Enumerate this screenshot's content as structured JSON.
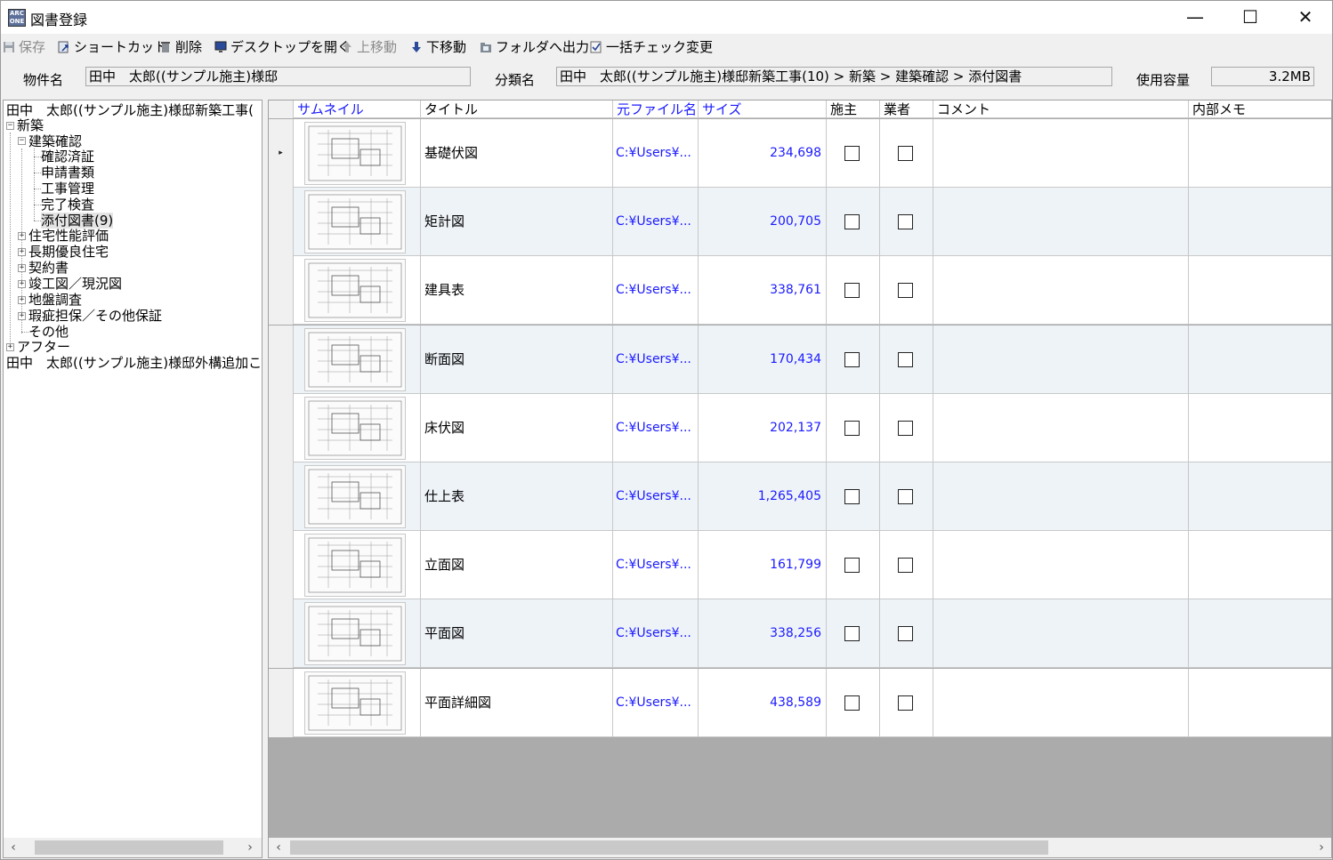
{
  "window": {
    "app_icon_text": "ARC ONE",
    "title": "図書登録",
    "minimize": "—",
    "maximize": "☐",
    "close": "✕"
  },
  "toolbar": {
    "save": "保存",
    "shortcut": "ショートカット",
    "delete": "削除",
    "open_desktop": "デスクトップを開く",
    "move_up": "上移動",
    "move_down": "下移動",
    "export_folder": "フォルダへ出力",
    "bulk_check": "一括チェック変更"
  },
  "header": {
    "property_label": "物件名",
    "property_value": "田中　太郎((サンプル施主)様邸",
    "category_label": "分類名",
    "category_value": "田中　太郎((サンプル施主)様邸新築工事(10) > 新築 > 建築確認 > 添付図書",
    "usage_label": "使用容量",
    "usage_value": "3.2MB"
  },
  "tree": {
    "root1": "田中　太郎((サンプル施主)様邸新築工事(",
    "shinchiku": "新築",
    "kenchiku_kakunin": "建築確認",
    "kakunin_zumisho": "確認済証",
    "shinsei_shorui": "申請書類",
    "koji_kanri": "工事管理",
    "kanryo_kensa": "完了検査",
    "tenpu_zusho": "添付図書(9)",
    "jutaku_seino": "住宅性能評価",
    "choki_yuryo": "長期優良住宅",
    "keiyakusho": "契約書",
    "shunkozu": "竣工図／現況図",
    "jiban_chosa": "地盤調査",
    "kashi_tanpo": "瑕疵担保／その他保証",
    "sonota": "その他",
    "after": "アフター",
    "root2": "田中　太郎((サンプル施主)様邸外構追加こ"
  },
  "grid": {
    "columns": {
      "thumbnail": "サムネイル",
      "title": "タイトル",
      "filename": "元ファイル名",
      "size": "サイズ",
      "owner": "施主",
      "vendor": "業者",
      "comment": "コメント",
      "memo": "内部メモ"
    },
    "current_row_marker": "▸",
    "rows": [
      {
        "title": "基礎伏図",
        "file": "C:¥Users¥...",
        "size": "234,698"
      },
      {
        "title": "矩計図",
        "file": "C:¥Users¥...",
        "size": "200,705"
      },
      {
        "title": "建具表",
        "file": "C:¥Users¥...",
        "size": "338,761"
      },
      {
        "title": "断面図",
        "file": "C:¥Users¥...",
        "size": "170,434"
      },
      {
        "title": "床伏図",
        "file": "C:¥Users¥...",
        "size": "202,137"
      },
      {
        "title": "仕上表",
        "file": "C:¥Users¥...",
        "size": "1,265,405"
      },
      {
        "title": "立面図",
        "file": "C:¥Users¥...",
        "size": "161,799"
      },
      {
        "title": "平面図",
        "file": "C:¥Users¥...",
        "size": "338,256"
      },
      {
        "title": "平面詳細図",
        "file": "C:¥Users¥...",
        "size": "438,589"
      }
    ]
  },
  "scroll": {
    "left": "‹",
    "right": "›"
  }
}
